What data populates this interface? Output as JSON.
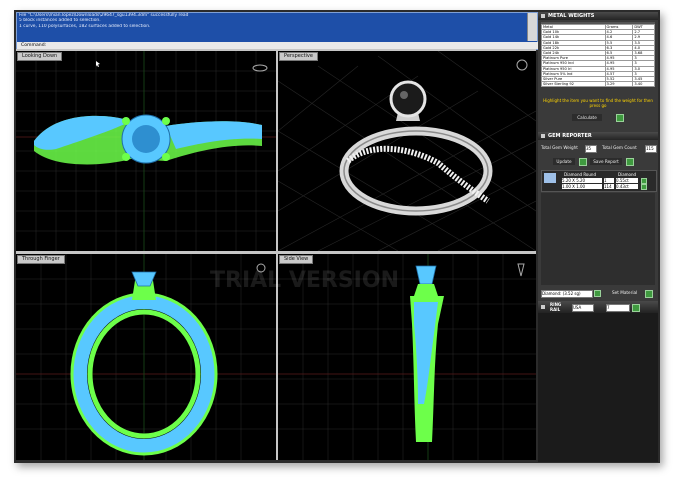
{
  "command_area": {
    "lines": [
      "File \"C:\\Users\\mian.lopez\\Downloads\\29647_sgu1394.3dm\" successfully read",
      "5 block instances added to selection.",
      "1 curve, 110 polysurfaces, 182 surfaces added to selection."
    ],
    "prompt": "Command:"
  },
  "viewports": [
    {
      "label": "Looking Down"
    },
    {
      "label": "Perspective"
    },
    {
      "label": "Through Finger"
    },
    {
      "label": "Side View"
    }
  ],
  "watermark": "TRIAL VERSION",
  "metal_weights": {
    "title": "METAL WEIGHTS",
    "columns": [
      "Metal",
      "Grams",
      "DWT"
    ],
    "rows": [
      [
        "Gold 10k",
        "4.2",
        "2.7"
      ],
      [
        "Gold 14k",
        "4.6",
        "2.9"
      ],
      [
        "Gold 18k",
        "5.5",
        "3.5"
      ],
      [
        "Gold 22k",
        "6.3",
        "4.0"
      ],
      [
        "Gold 24k",
        "6.5",
        "3.68"
      ],
      [
        "Platinum Pure",
        "4.95",
        "3"
      ],
      [
        "Platinum 950 Ind",
        "4.95",
        "3"
      ],
      [
        "Platinum 950 Iri",
        "4.95",
        "3.0"
      ],
      [
        "Platinum 5% Ind",
        "4.57",
        "3"
      ],
      [
        "Silver Pure",
        "5.52",
        "3.45"
      ],
      [
        "Silver Sterling 92",
        "3.29",
        "3.40"
      ]
    ],
    "hint": "Highlight the item you want to find the weight for then press go",
    "calculate_label": "Calculate"
  },
  "gem_reporter": {
    "title": "GEM REPORTER",
    "total_weight_label": "Total Gem Weight",
    "total_weight_value": "35",
    "total_count_label": "Total Gem Count",
    "total_count_value": "115",
    "update_label": "Update",
    "save_label": "Save Report",
    "columns": [
      "Diamond Round",
      "Diamond"
    ],
    "rows": [
      [
        "5.20 X 5.20",
        "1",
        "0.55ct"
      ],
      [
        "1.00 X 1.00",
        "114",
        "0.43ct"
      ]
    ],
    "material_value": "Diamond: (3.52 sg)",
    "set_material_label": "Set Material"
  },
  "ring_rail": {
    "title": "RING RAIL",
    "standard": "USA",
    "size": "7"
  },
  "colors": {
    "wire_blue": "#58c8ff",
    "wire_green": "#6dff4a",
    "command_blue": "#1e4fa8"
  }
}
